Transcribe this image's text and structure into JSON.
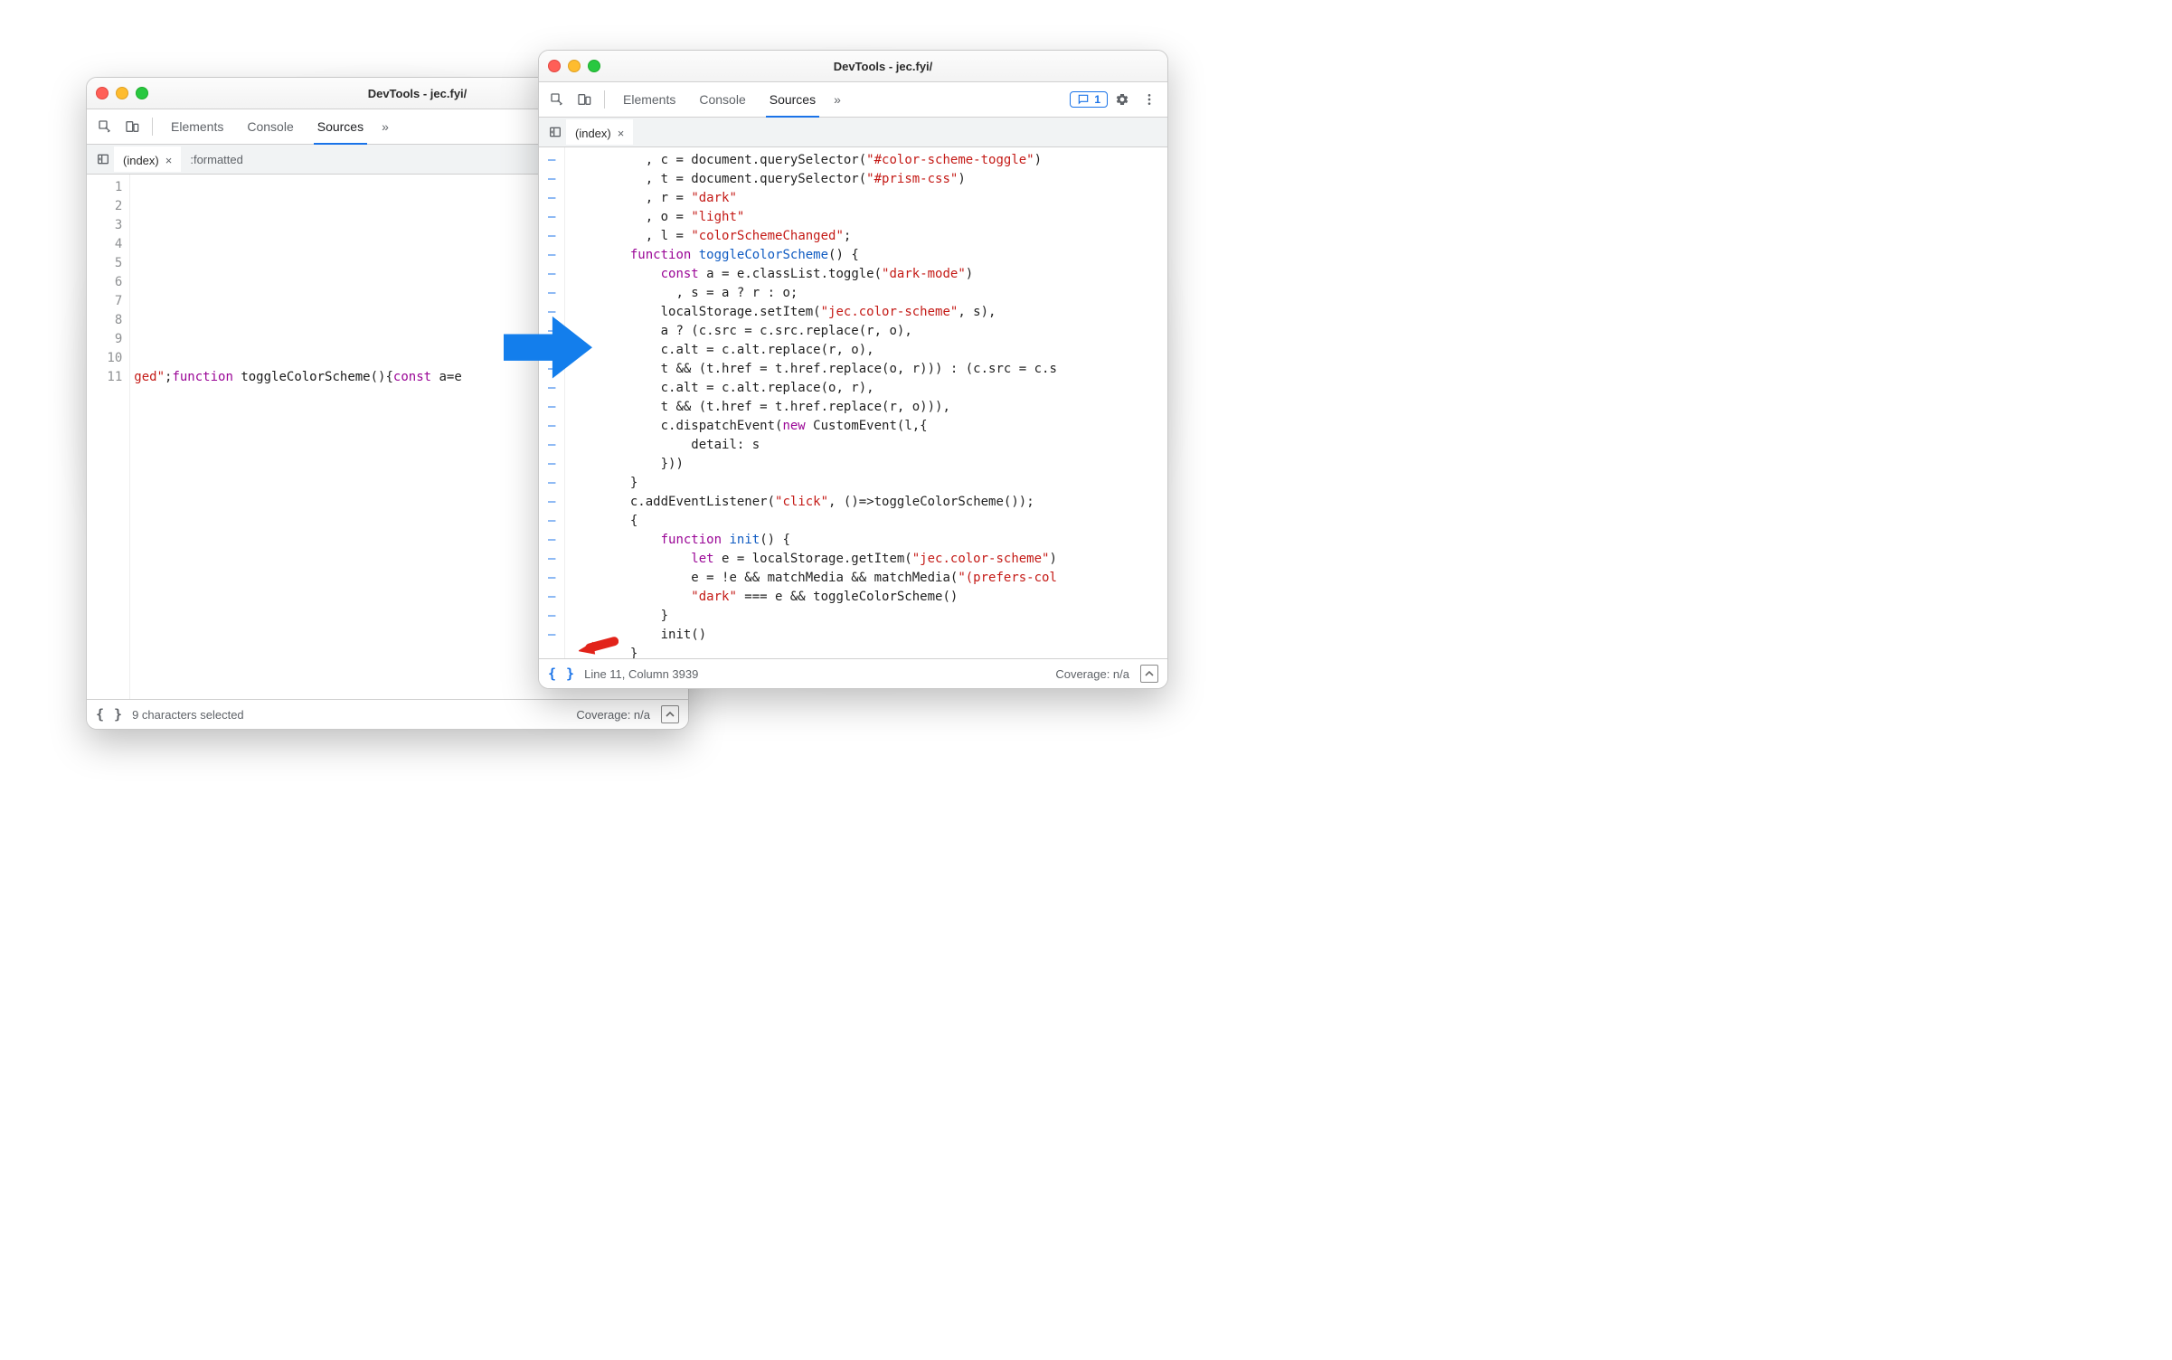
{
  "window_a": {
    "title": "DevTools - jec.fyi/",
    "tabs": {
      "elements": "Elements",
      "console": "Console",
      "sources": "Sources",
      "more": "»"
    },
    "files": {
      "index": "(index)",
      "formatted": ":formatted"
    },
    "gutter_lines": "  1\n  2\n  3\n  4\n  5\n  6\n  7\n  8\n  9\n 10\n 11",
    "code_line11_prefix": "ged\"",
    "code_line11_fn": "function",
    "code_line11_name": " toggleColorScheme",
    "code_line11_rest": "(){",
    "code_line11_const": "const",
    "code_line11_tail": " a=e",
    "status_left": "9 characters selected",
    "status_coverage": "Coverage: n/a"
  },
  "window_b": {
    "title": "DevTools - jec.fyi/",
    "tabs": {
      "elements": "Elements",
      "console": "Console",
      "sources": "Sources",
      "more": "»"
    },
    "issues_count": "1",
    "files": {
      "index": "(index)"
    },
    "dash_count": 26,
    "code_lines": [
      {
        "indent": "          , ",
        "segments": [
          {
            "t": "c = document.querySelector(",
            "c": "pl"
          },
          {
            "t": "\"#color-scheme-toggle\"",
            "c": "str"
          },
          {
            "t": ")",
            "c": "pl"
          }
        ]
      },
      {
        "indent": "          , ",
        "segments": [
          {
            "t": "t = document.querySelector(",
            "c": "pl"
          },
          {
            "t": "\"#prism-css\"",
            "c": "str"
          },
          {
            "t": ")",
            "c": "pl"
          }
        ]
      },
      {
        "indent": "          , ",
        "segments": [
          {
            "t": "r = ",
            "c": "pl"
          },
          {
            "t": "\"dark\"",
            "c": "str"
          }
        ]
      },
      {
        "indent": "          , ",
        "segments": [
          {
            "t": "o = ",
            "c": "pl"
          },
          {
            "t": "\"light\"",
            "c": "str"
          }
        ]
      },
      {
        "indent": "          , ",
        "segments": [
          {
            "t": "l = ",
            "c": "pl"
          },
          {
            "t": "\"colorSchemeChanged\"",
            "c": "str"
          },
          {
            "t": ";",
            "c": "pl"
          }
        ]
      },
      {
        "indent": "        ",
        "segments": [
          {
            "t": "function",
            "c": "kw"
          },
          {
            "t": " toggleColorScheme",
            "c": "name"
          },
          {
            "t": "() {",
            "c": "pl"
          }
        ]
      },
      {
        "indent": "            ",
        "segments": [
          {
            "t": "const",
            "c": "kw"
          },
          {
            "t": " a = e.classList.toggle(",
            "c": "pl"
          },
          {
            "t": "\"dark-mode\"",
            "c": "str"
          },
          {
            "t": ")",
            "c": "pl"
          }
        ]
      },
      {
        "indent": "              , ",
        "segments": [
          {
            "t": "s = a ? r : o;",
            "c": "pl"
          }
        ]
      },
      {
        "indent": "            ",
        "segments": [
          {
            "t": "localStorage.setItem(",
            "c": "pl"
          },
          {
            "t": "\"jec.color-scheme\"",
            "c": "str"
          },
          {
            "t": ", s),",
            "c": "pl"
          }
        ]
      },
      {
        "indent": "            ",
        "segments": [
          {
            "t": "a ? (c.src = c.src.replace(r, o),",
            "c": "pl"
          }
        ]
      },
      {
        "indent": "            ",
        "segments": [
          {
            "t": "c.alt = c.alt.replace(r, o),",
            "c": "pl"
          }
        ]
      },
      {
        "indent": "            ",
        "segments": [
          {
            "t": "t && (t.href = t.href.replace(o, r))) : (c.src = c.s",
            "c": "pl"
          }
        ]
      },
      {
        "indent": "            ",
        "segments": [
          {
            "t": "c.alt = c.alt.replace(o, r),",
            "c": "pl"
          }
        ]
      },
      {
        "indent": "            ",
        "segments": [
          {
            "t": "t && (t.href = t.href.replace(r, o))),",
            "c": "pl"
          }
        ]
      },
      {
        "indent": "            ",
        "segments": [
          {
            "t": "c.dispatchEvent(",
            "c": "pl"
          },
          {
            "t": "new",
            "c": "kw"
          },
          {
            "t": " CustomEvent(l,{",
            "c": "pl"
          }
        ]
      },
      {
        "indent": "                ",
        "segments": [
          {
            "t": "detail: s",
            "c": "pl"
          }
        ]
      },
      {
        "indent": "            ",
        "segments": [
          {
            "t": "}))",
            "c": "pl"
          }
        ]
      },
      {
        "indent": "        ",
        "segments": [
          {
            "t": "}",
            "c": "pl"
          }
        ]
      },
      {
        "indent": "        ",
        "segments": [
          {
            "t": "c.addEventListener(",
            "c": "pl"
          },
          {
            "t": "\"click\"",
            "c": "str"
          },
          {
            "t": ", ()=>toggleColorScheme());",
            "c": "pl"
          }
        ]
      },
      {
        "indent": "        ",
        "segments": [
          {
            "t": "{",
            "c": "pl"
          }
        ]
      },
      {
        "indent": "            ",
        "segments": [
          {
            "t": "function",
            "c": "kw"
          },
          {
            "t": " init",
            "c": "name"
          },
          {
            "t": "() {",
            "c": "pl"
          }
        ]
      },
      {
        "indent": "                ",
        "segments": [
          {
            "t": "let",
            "c": "kw"
          },
          {
            "t": " e = localStorage.getItem(",
            "c": "pl"
          },
          {
            "t": "\"jec.color-scheme\"",
            "c": "str"
          },
          {
            "t": ")",
            "c": "pl"
          }
        ]
      },
      {
        "indent": "                ",
        "segments": [
          {
            "t": "e = !e && matchMedia && matchMedia(",
            "c": "pl"
          },
          {
            "t": "\"(prefers-col",
            "c": "str"
          }
        ]
      },
      {
        "indent": "                ",
        "segments": [
          {
            "t": "\"dark\"",
            "c": "str"
          },
          {
            "t": " === e && toggleColorScheme()",
            "c": "pl"
          }
        ]
      },
      {
        "indent": "            ",
        "segments": [
          {
            "t": "}",
            "c": "pl"
          }
        ]
      },
      {
        "indent": "            ",
        "segments": [
          {
            "t": "init()",
            "c": "pl"
          }
        ]
      },
      {
        "indent": "        ",
        "segments": [
          {
            "t": "}",
            "c": "pl"
          }
        ]
      },
      {
        "indent": "    ",
        "segments": [
          {
            "t": "}",
            "c": "pl"
          }
        ]
      }
    ],
    "status_left": "Line 11, Column 3939",
    "status_coverage": "Coverage: n/a"
  }
}
